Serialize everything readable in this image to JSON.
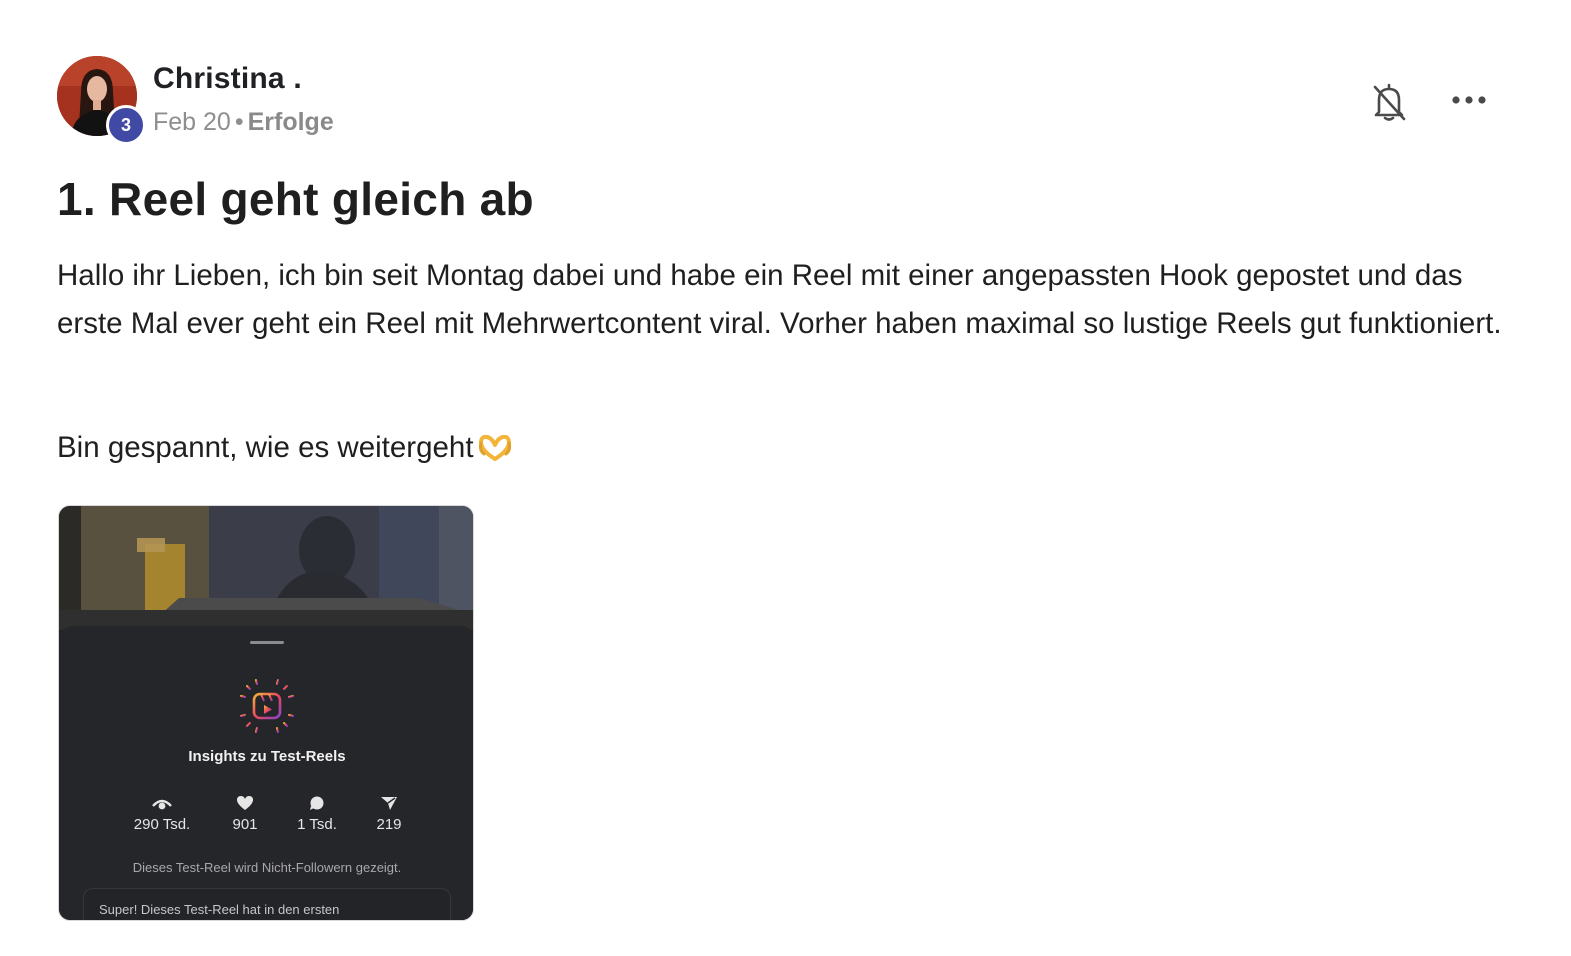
{
  "post": {
    "author": {
      "name": "Christina .",
      "level": "3"
    },
    "meta": {
      "date": "Feb 20",
      "separator": "•",
      "category": "Erfolge"
    },
    "actions": {
      "notifications_icon": "bell-off-icon",
      "more_icon": "more-horizontal-icon"
    },
    "title": "1. Reel geht gleich ab",
    "body": [
      "Hallo ihr Lieben, ich bin seit Montag dabei und habe ein Reel mit einer angepassten Hook gepostet und das erste Mal ever geht ein Reel mit Mehrwertcontent viral. Vorher haben maximal so lustige Reels gut funktioniert.",
      "Bin gespannt, wie es weitergeht"
    ],
    "body_emoji_icon": "heart-hands-emoji",
    "attachment": {
      "sheet_title": "Insights zu Test-Reels",
      "stats": [
        {
          "icon": "eye-icon",
          "value": "290 Tsd."
        },
        {
          "icon": "heart-icon",
          "value": "901"
        },
        {
          "icon": "comment-icon",
          "value": "1 Tsd."
        },
        {
          "icon": "share-icon",
          "value": "219"
        }
      ],
      "note": "Dieses Test-Reel wird Nicht-Followern gezeigt.",
      "card_text": "Super! Dieses Test-Reel hat in den ersten"
    }
  },
  "colors": {
    "badge": "#4049a4",
    "text": "#1f1f1f",
    "meta": "#8e8e8e",
    "sheet_bg": "#25262a"
  }
}
